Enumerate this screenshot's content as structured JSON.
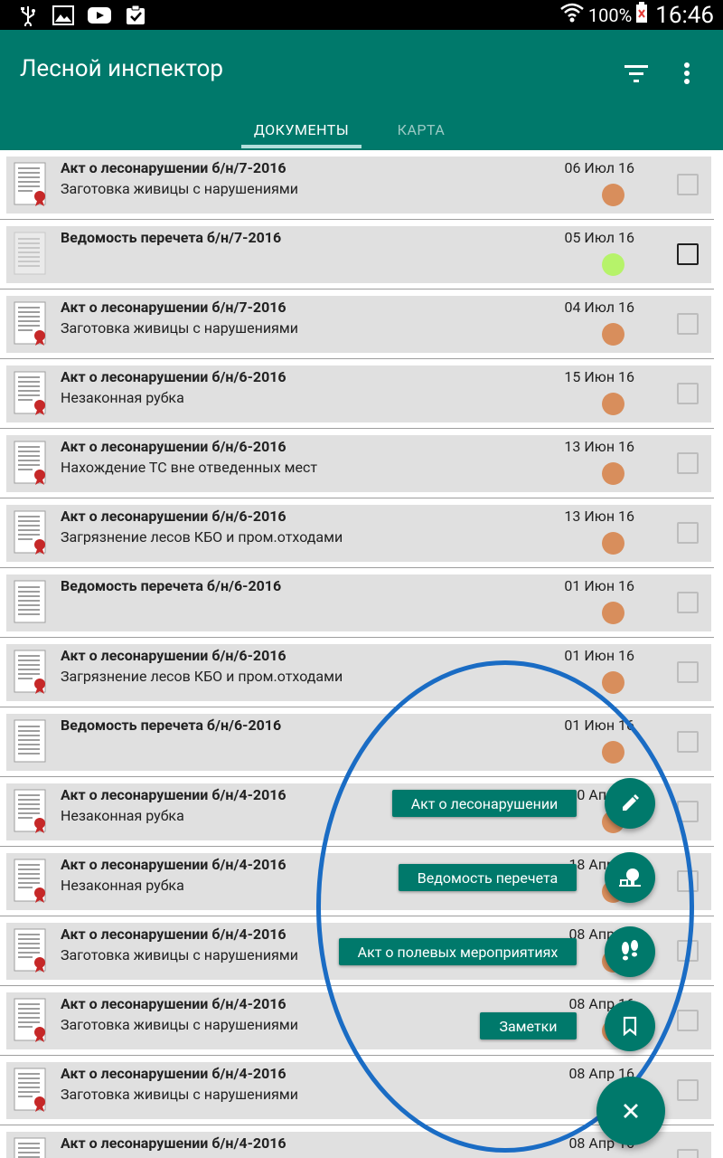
{
  "status_bar": {
    "battery": "100%",
    "time": "16:46",
    "icons": [
      "usb-icon",
      "image-icon",
      "youtube-icon",
      "clipboard-check-icon",
      "wifi-icon",
      "battery-icon"
    ]
  },
  "app": {
    "title": "Лесной инспектор",
    "primary_color": "#00796b",
    "tabs": [
      {
        "label": "ДОКУМЕНТЫ",
        "selected": true
      },
      {
        "label": "КАРТА",
        "selected": false
      }
    ]
  },
  "documents": [
    {
      "title": "Акт о лесонарушении б/н/7-2016",
      "subtitle": "Заготовка живицы с нарушениями",
      "date": "06 Июл 16",
      "status": "orange",
      "icon": "act-document-icon",
      "checked": false
    },
    {
      "title": "Ведомость перечета б/н/7-2016",
      "subtitle": "",
      "date": "05 Июл 16",
      "status": "green",
      "icon": "statement-document-icon-faded",
      "checked": false
    },
    {
      "title": "Акт о лесонарушении б/н/7-2016",
      "subtitle": "Заготовка живицы с нарушениями",
      "date": "04 Июл 16",
      "status": "orange",
      "icon": "act-document-icon",
      "checked": false
    },
    {
      "title": "Акт о лесонарушении б/н/6-2016",
      "subtitle": "Незаконная рубка",
      "date": "15 Июн 16",
      "status": "orange",
      "icon": "act-document-icon",
      "checked": false
    },
    {
      "title": "Акт о лесонарушении б/н/6-2016",
      "subtitle": "Нахождение ТС вне отведенных мест",
      "date": "13 Июн 16",
      "status": "orange",
      "icon": "act-document-icon",
      "checked": false
    },
    {
      "title": "Акт о лесонарушении б/н/6-2016",
      "subtitle": "Загрязнение лесов КБО и пром.отходами",
      "date": "13 Июн 16",
      "status": "orange",
      "icon": "act-document-icon",
      "checked": false
    },
    {
      "title": "Ведомость перечета б/н/6-2016",
      "subtitle": "",
      "date": "01 Июн 16",
      "status": "orange",
      "icon": "statement-document-icon",
      "checked": false
    },
    {
      "title": "Акт о лесонарушении б/н/6-2016",
      "subtitle": "Загрязнение лесов КБО и пром.отходами",
      "date": "01 Июн 16",
      "status": "orange",
      "icon": "act-document-icon",
      "checked": false
    },
    {
      "title": "Ведомость перечета б/н/6-2016",
      "subtitle": "",
      "date": "01 Июн 16",
      "status": "orange",
      "icon": "statement-document-icon",
      "checked": false
    },
    {
      "title": "Акт о лесонарушении б/н/4-2016",
      "subtitle": "Незаконная рубка",
      "date": "20 Апр 16",
      "status": "orange",
      "icon": "act-document-icon",
      "checked": false
    },
    {
      "title": "Акт о лесонарушении б/н/4-2016",
      "subtitle": "Незаконная рубка",
      "date": "18 Апр 16",
      "status": "orange",
      "icon": "act-document-icon",
      "checked": false
    },
    {
      "title": "Акт о лесонарушении б/н/4-2016",
      "subtitle": "Заготовка живицы с нарушениями",
      "date": "08 Апр 16",
      "status": "orange",
      "icon": "act-document-icon",
      "checked": false
    },
    {
      "title": "Акт о лесонарушении б/н/4-2016",
      "subtitle": "Заготовка живицы с нарушениями",
      "date": "08 Апр 16",
      "status": "orange",
      "icon": "act-document-icon",
      "checked": false
    },
    {
      "title": "Акт о лесонарушении б/н/4-2016",
      "subtitle": "Заготовка живицы с нарушениями",
      "date": "08 Апр 16",
      "status": "orange",
      "icon": "act-document-icon",
      "checked": false
    },
    {
      "title": "Акт о лесонарушении б/н/4-2016",
      "subtitle": "",
      "date": "08 Апр 16",
      "status": "orange",
      "icon": "act-document-icon",
      "checked": false
    }
  ],
  "status_colors": {
    "orange": "#d88e5c",
    "green": "#b6f36a"
  },
  "fab_menu": {
    "actions": [
      {
        "label": "Акт о лесонарушении",
        "icon": "pencil-icon"
      },
      {
        "label": "Ведомость перечета",
        "icon": "tree-stump-icon"
      },
      {
        "label": "Акт о полевых мероприятиях",
        "icon": "footprints-icon"
      },
      {
        "label": "Заметки",
        "icon": "bookmark-icon"
      }
    ],
    "close_icon": "close-icon"
  },
  "annotation_color": "#1a6cc4"
}
